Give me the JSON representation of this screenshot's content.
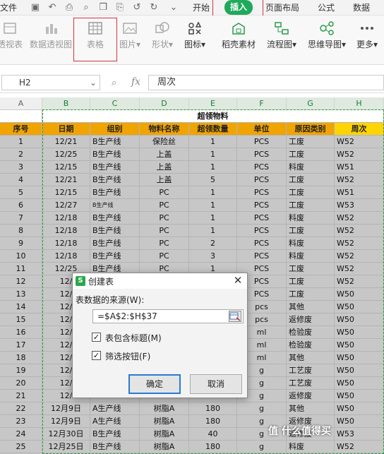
{
  "menubar": {
    "file": "文件",
    "tabs": [
      "开始",
      "插入",
      "页面布局",
      "公式",
      "数据"
    ],
    "active_tab": "插入"
  },
  "ribbon": {
    "items": [
      "透视表",
      "数据透视图",
      "表格",
      "图片",
      "形状",
      "图标",
      "稻壳素材",
      "流程图",
      "思维导图",
      "更多"
    ]
  },
  "formula_bar": {
    "cell_ref": "H2",
    "fx": "fx",
    "content": "周次"
  },
  "grid": {
    "columns": [
      "A",
      "B",
      "C",
      "D",
      "E",
      "F",
      "G",
      "H"
    ],
    "merged_title": "超领物料",
    "headers": [
      "序号",
      "日期",
      "组别",
      "物料名称",
      "超领数量",
      "单位",
      "原因类别",
      "周次"
    ],
    "rows": [
      [
        "1",
        "12/21",
        "B生产线",
        "保险丝",
        "1",
        "PCS",
        "工废",
        "W52"
      ],
      [
        "2",
        "12/25",
        "B生产线",
        "上盖",
        "1",
        "PCS",
        "工废",
        "W52"
      ],
      [
        "3",
        "12/15",
        "B生产线",
        "上盖",
        "1",
        "PCS",
        "料废",
        "W51"
      ],
      [
        "4",
        "12/21",
        "B生产线",
        "上盖",
        "5",
        "PCS",
        "工废",
        "W52"
      ],
      [
        "5",
        "12/15",
        "B生产线",
        "PC",
        "1",
        "PCS",
        "工废",
        "W51"
      ],
      [
        "6",
        "12/27",
        "B生产线",
        "PC",
        "1",
        "PCS",
        "工废",
        "W53"
      ],
      [
        "7",
        "12/18",
        "B生产线",
        "PC",
        "1",
        "PCS",
        "料废",
        "W52"
      ],
      [
        "8",
        "12/18",
        "B生产线",
        "PC",
        "1",
        "PCS",
        "工废",
        "W52"
      ],
      [
        "9",
        "12/18",
        "B生产线",
        "PC",
        "2",
        "PCS",
        "料废",
        "W52"
      ],
      [
        "10",
        "12/18",
        "B生产线",
        "PC",
        "3",
        "PCS",
        "料废",
        "W52"
      ],
      [
        "11",
        "12/25",
        "B生产线",
        "PC",
        "1",
        "PCS",
        "工废",
        "W52"
      ],
      [
        "12",
        "12/",
        "",
        "",
        "",
        "PCS",
        "工废",
        "W52"
      ],
      [
        "13",
        "12/",
        "",
        "",
        "",
        "PCS",
        "工废",
        "W50"
      ],
      [
        "14",
        "12/",
        "",
        "",
        "",
        "pcs",
        "其他",
        "W50"
      ],
      [
        "15",
        "12/",
        "",
        "",
        "",
        "pcs",
        "返修废",
        "W50"
      ],
      [
        "16",
        "12/",
        "",
        "",
        "",
        "ml",
        "检验废",
        "W50"
      ],
      [
        "17",
        "12/",
        "",
        "",
        "",
        "ml",
        "检验废",
        "W50"
      ],
      [
        "18",
        "12/",
        "",
        "",
        "",
        "ml",
        "其他",
        "W50"
      ],
      [
        "19",
        "12/",
        "",
        "",
        "",
        "g",
        "工艺废",
        "W50"
      ],
      [
        "20",
        "12/",
        "",
        "",
        "",
        "g",
        "工艺废",
        "W50"
      ],
      [
        "21",
        "12/",
        "",
        "",
        "",
        "g",
        "返修废",
        "W50"
      ],
      [
        "22",
        "12月9日",
        "A生产线",
        "树脂A",
        "180",
        "g",
        "其他",
        "W50"
      ],
      [
        "23",
        "12月9日",
        "A生产线",
        "树脂A",
        "180",
        "g",
        "返修废",
        "W50"
      ],
      [
        "24",
        "12月30日",
        "B生产线",
        "树脂A",
        "40",
        "g",
        "返修废",
        "W53"
      ],
      [
        "25",
        "12月25日",
        "B生产线",
        "树脂A",
        "180",
        "g",
        "料废",
        "W52"
      ]
    ]
  },
  "dialog": {
    "title": "创建表",
    "logo": "S",
    "source_label": "表数据的来源(W):",
    "source_value": "=$A$2:$H$37",
    "checkbox_header": "表包含标题(M)",
    "checkbox_filter": "筛选按钮(F)",
    "ok": "确定",
    "cancel": "取消"
  },
  "watermark": "值 什么值得买",
  "colors": {
    "accent": "#1fa95b",
    "header_orange": "#f0a400",
    "header_yellow": "#ffd400",
    "highlight_red": "#d8323c"
  }
}
